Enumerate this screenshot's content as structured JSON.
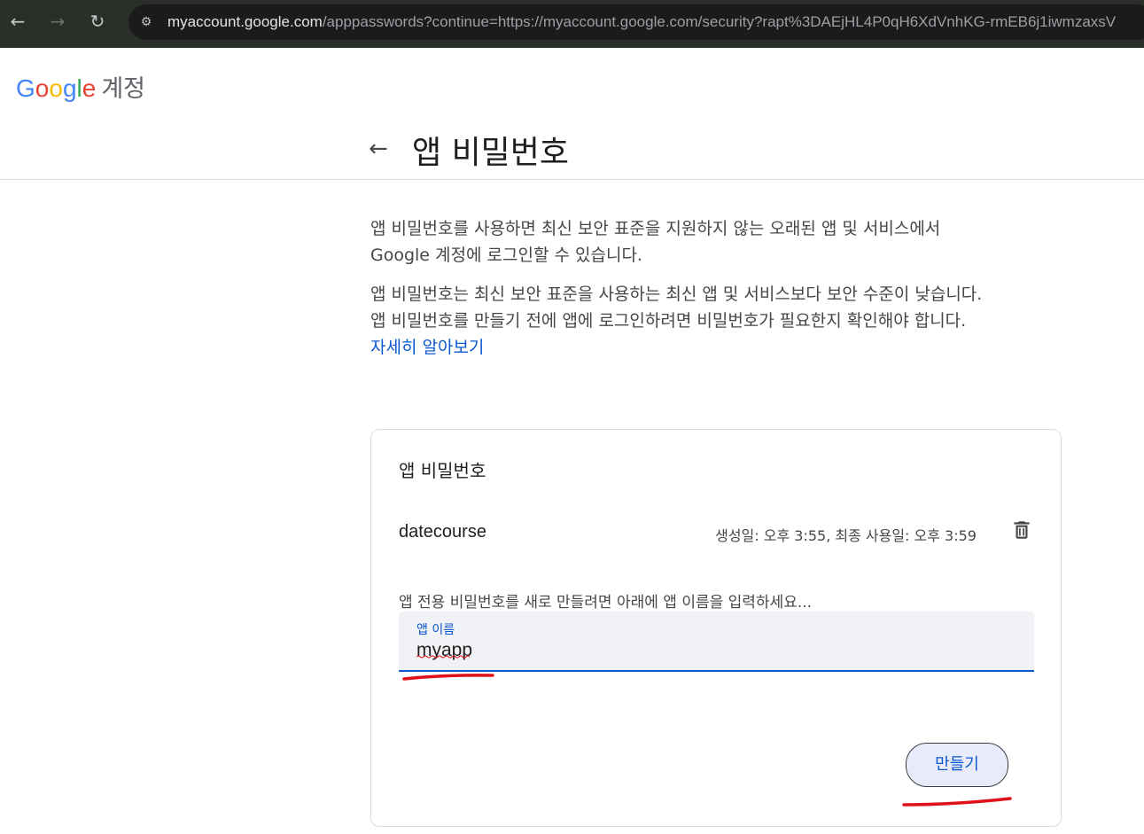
{
  "browser": {
    "url_host": "myaccount.google.com",
    "url_rest": "/apppasswords?continue=https://myaccount.google.com/security?rapt%3DAEjHL4P0qH6XdVnhKG-rmEB6j1iwmzaxsV",
    "icons": [
      "back-icon",
      "forward-icon",
      "reload-icon",
      "site-info-icon"
    ]
  },
  "header": {
    "brand_letters": [
      "G",
      "o",
      "o",
      "g",
      "l",
      "e"
    ],
    "brand_suffix": "계정"
  },
  "page": {
    "title": "앱 비밀번호",
    "intro_1": "앱 비밀번호를 사용하면 최신 보안 표준을 지원하지 않는 오래된 앱 및 서비스에서 Google 계정에 로그인할 수 있습니다.",
    "intro_2": "앱 비밀번호는 최신 보안 표준을 사용하는 최신 앱 및 서비스보다 보안 수준이 낮습니다. 앱 비밀번호를 만들기 전에 앱에 로그인하려면 비밀번호가 필요한지 확인해야 합니다.",
    "learn_more": "자세히 알아보기"
  },
  "card": {
    "title": "앱 비밀번호",
    "passwords": [
      {
        "name": "datecourse",
        "meta": "생성일: 오후 3:55, 최종 사용일: 오후 3:59"
      }
    ],
    "hint": "앱 전용 비밀번호를 새로 만들려면 아래에 앱 이름을 입력하세요...",
    "field_label": "앱 이름",
    "field_value": "myapp",
    "create_label": "만들기"
  },
  "colors": {
    "accent": "#0b57d0",
    "annotation": "#e0101a",
    "browser_chrome": "#2b2f2a"
  }
}
